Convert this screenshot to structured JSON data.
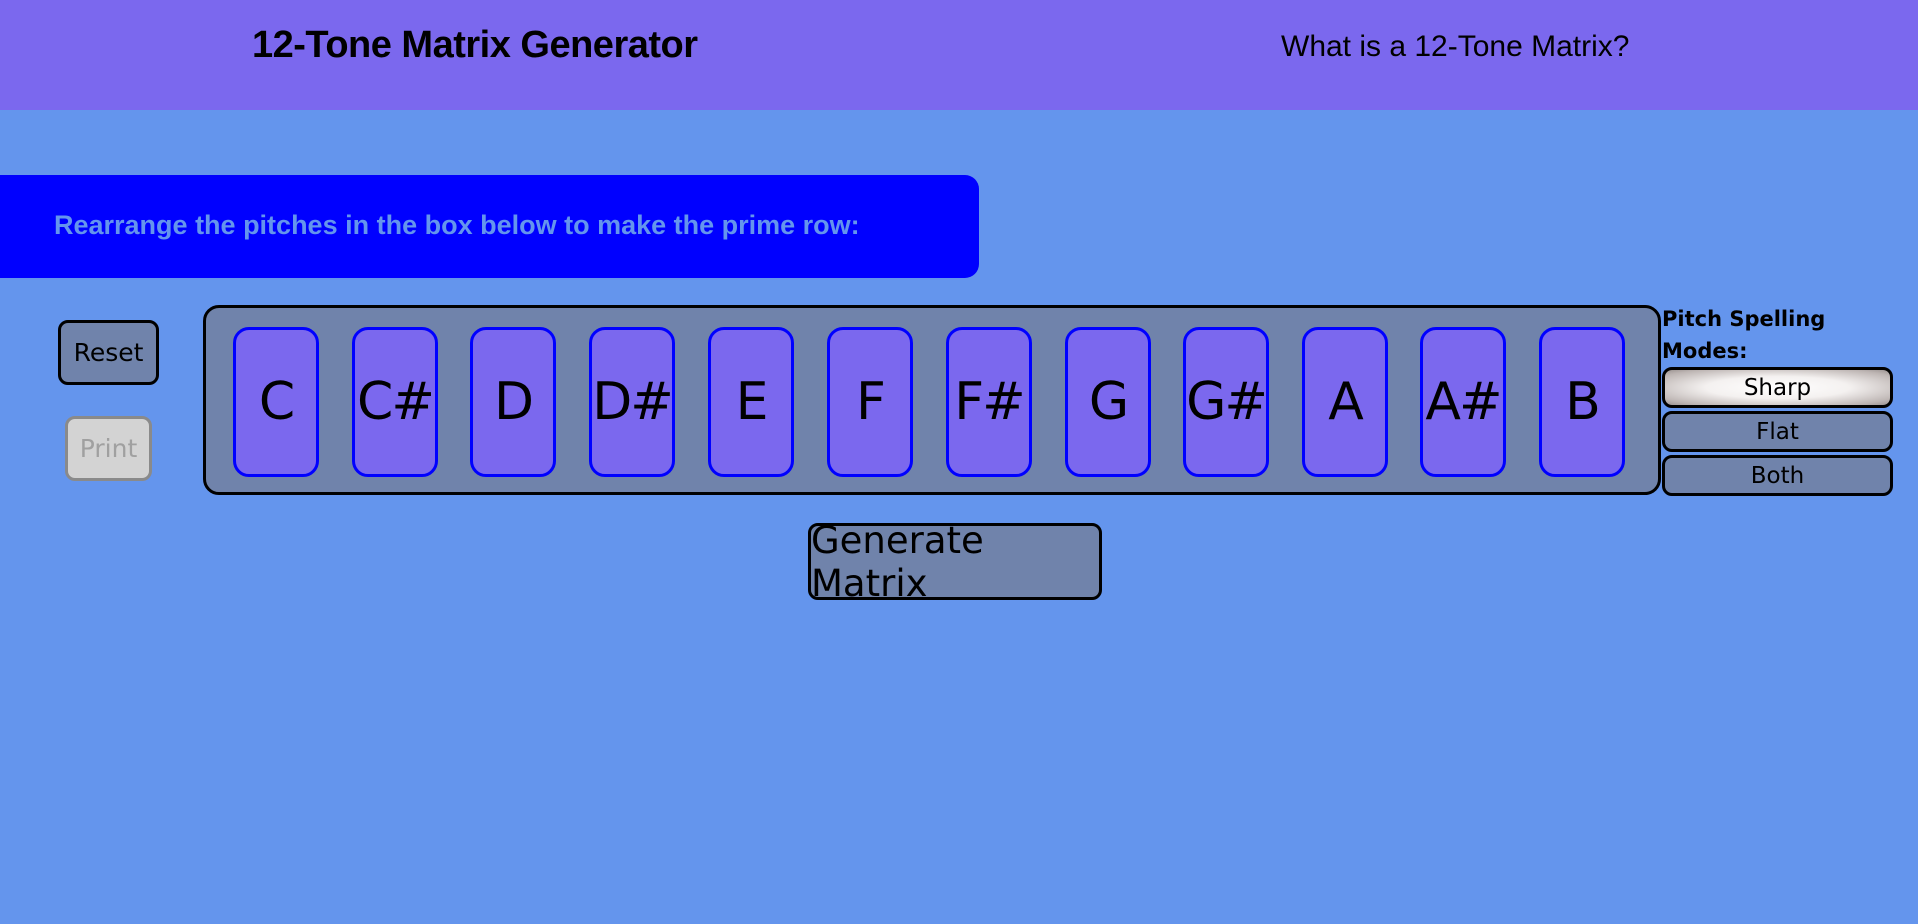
{
  "header": {
    "title": "12-Tone Matrix Generator",
    "nav_link": "What is a 12-Tone Matrix?"
  },
  "instructions": {
    "text": "Rearrange the pitches in the box below to make the prime row:"
  },
  "controls": {
    "reset_label": "Reset",
    "print_label": "Print",
    "print_disabled": true,
    "generate_label": "Generate Matrix"
  },
  "pitch_row": {
    "pitches": [
      "C",
      "C#",
      "D",
      "D#",
      "E",
      "F",
      "F#",
      "G",
      "G#",
      "A",
      "A#",
      "B"
    ]
  },
  "spelling_modes": {
    "label": "Pitch Spelling Modes:",
    "selected": "Sharp",
    "options": [
      {
        "label": "Sharp",
        "active": true
      },
      {
        "label": "Flat",
        "active": false
      },
      {
        "label": "Both",
        "active": false
      }
    ]
  },
  "colors": {
    "header_bg": "#7B68EE",
    "page_bg": "#6495ED",
    "banner_bg": "#0000FF",
    "box_bg": "#7083AB",
    "card_bg": "#7B68EE",
    "card_border": "#0000FF"
  }
}
